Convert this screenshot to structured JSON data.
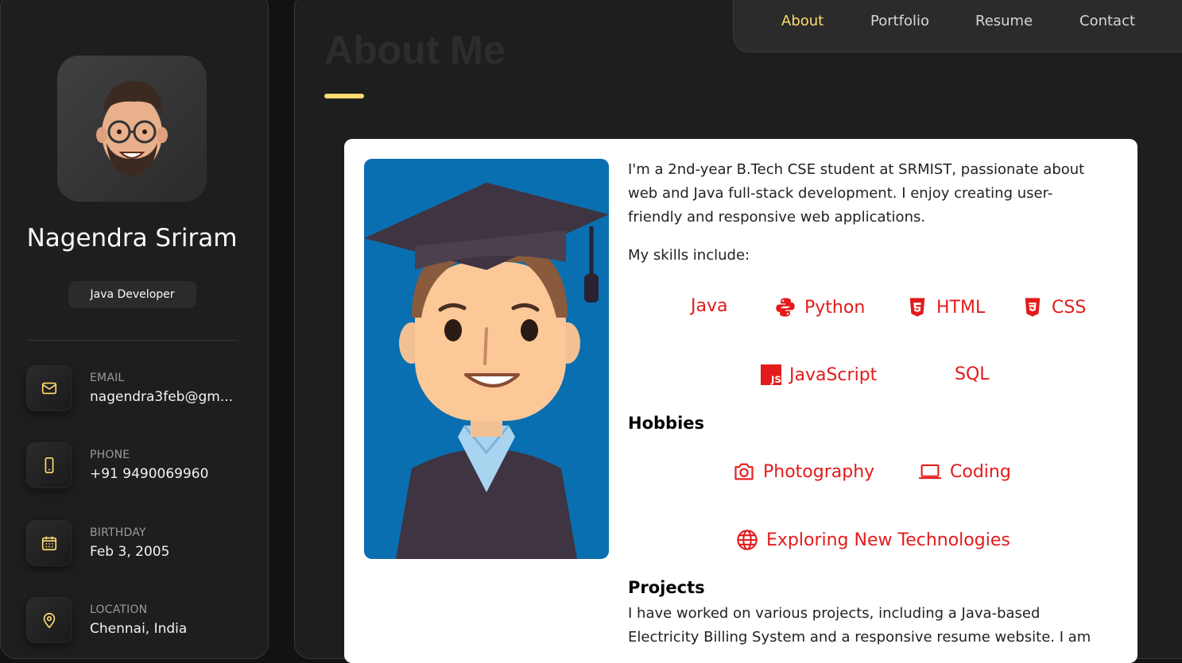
{
  "profile": {
    "name": "Nagendra Sriram",
    "role": "Java Developer"
  },
  "contacts": [
    {
      "title": "EMAIL",
      "value": "nagendra3feb@gm...",
      "icon": "mail-icon"
    },
    {
      "title": "PHONE",
      "value": "+91 9490069960",
      "icon": "phone-icon"
    },
    {
      "title": "BIRTHDAY",
      "value": "Feb 3, 2005",
      "icon": "calendar-icon"
    },
    {
      "title": "LOCATION",
      "value": "Chennai, India",
      "icon": "location-icon"
    }
  ],
  "nav": [
    "About",
    "Portfolio",
    "Resume",
    "Contact"
  ],
  "nav_active": "About",
  "page": {
    "heading": "About Me"
  },
  "about": {
    "intro": "I'm a 2nd-year B.Tech CSE student at SRMIST, passionate about web and Java full-stack development. I enjoy creating user-friendly and responsive web applications.",
    "skills_label": "My skills include:",
    "skills": [
      "Java",
      "Python",
      "HTML",
      "CSS",
      "JavaScript",
      "SQL"
    ],
    "hobbies_heading": "Hobbies",
    "hobbies": [
      "Photography",
      "Coding",
      "Exploring New Technologies"
    ],
    "projects_heading": "Projects",
    "projects_text": "I have worked on various projects, including a Java-based Electricity Billing System and a responsive resume website. I am"
  },
  "colors": {
    "accent": "#ffdb70",
    "skill_red": "#e31b1b",
    "card_bg": "#ffffff",
    "image_bg": "#0a6fb0"
  }
}
